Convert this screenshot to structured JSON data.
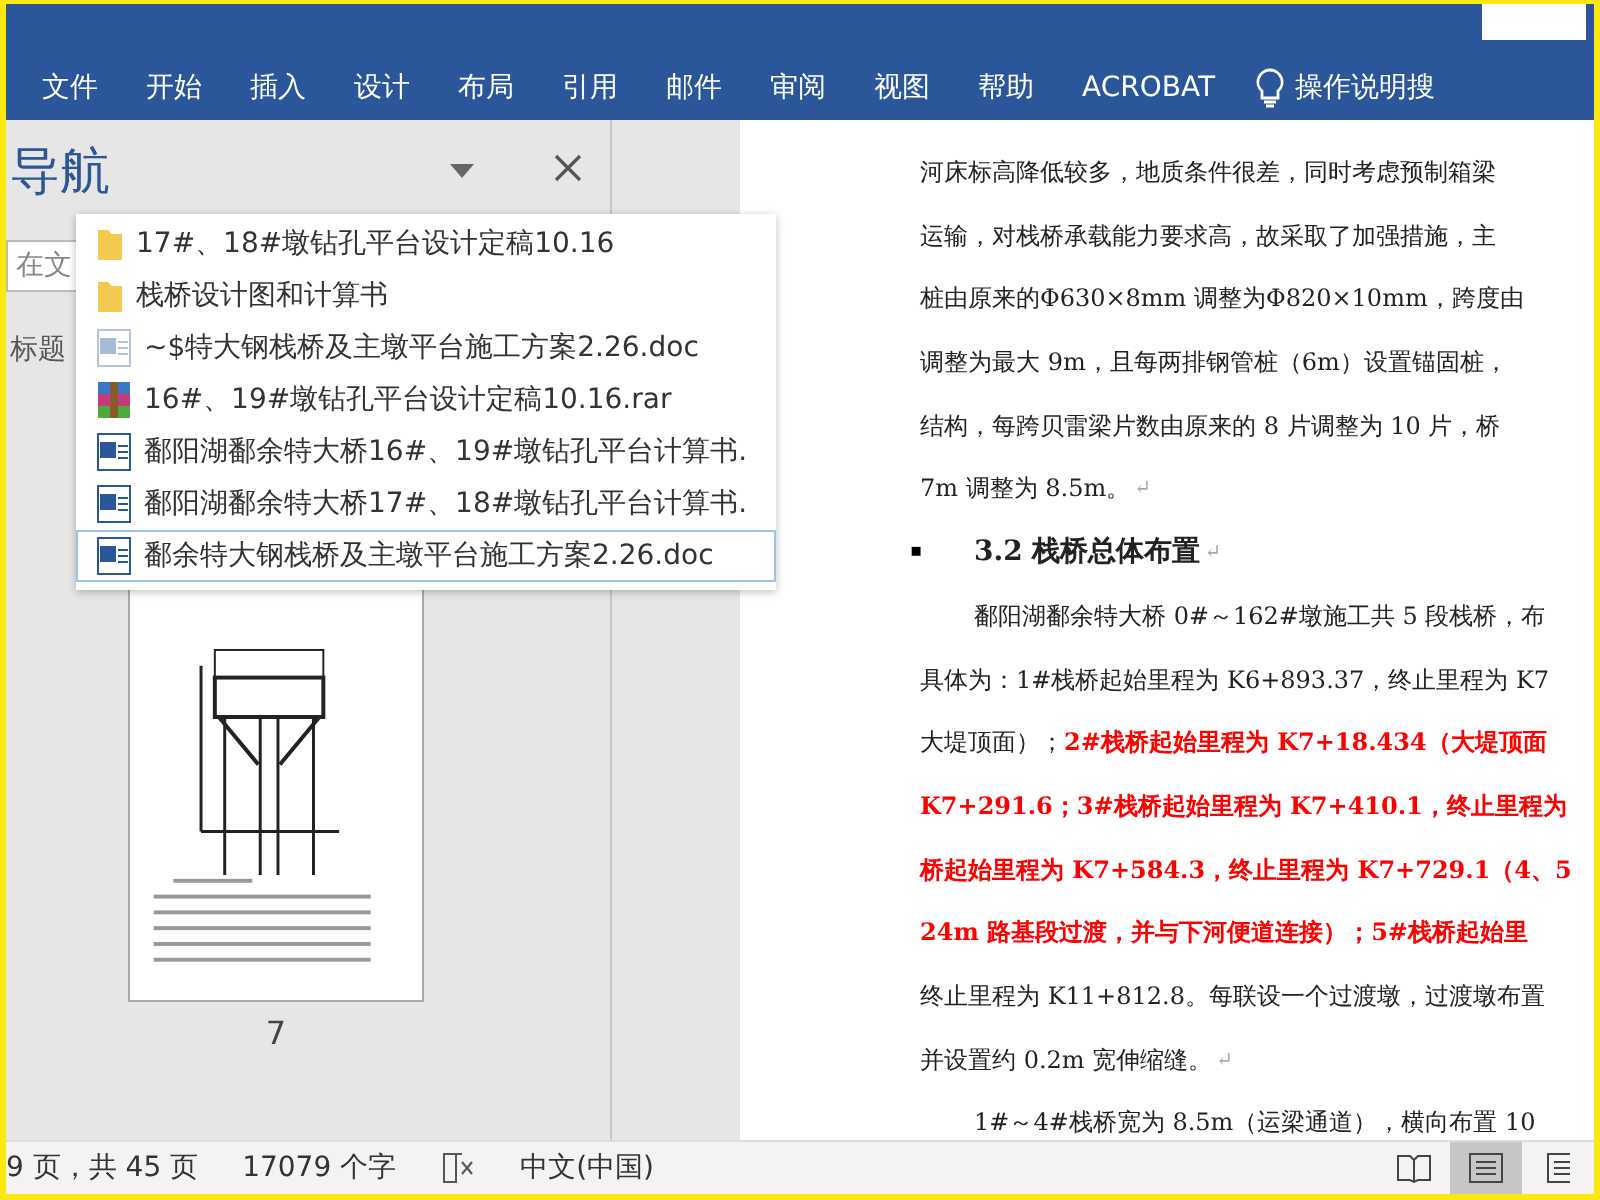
{
  "ribbon": {
    "tabs": [
      {
        "label": "文件"
      },
      {
        "label": "开始"
      },
      {
        "label": "插入"
      },
      {
        "label": "设计"
      },
      {
        "label": "布局"
      },
      {
        "label": "引用"
      },
      {
        "label": "邮件"
      },
      {
        "label": "审阅"
      },
      {
        "label": "视图"
      },
      {
        "label": "帮助"
      },
      {
        "label": "ACROBAT"
      }
    ],
    "tell_me": "操作说明搜"
  },
  "navigation": {
    "title": "导航",
    "search": {
      "placeholder": "在文"
    },
    "tab_label": "标题",
    "thumbnail_page": "7"
  },
  "file_popup": {
    "items": [
      {
        "kind": "folder",
        "name": "17#、18#墩钻孔平台设计定稿10.16",
        "selected": false
      },
      {
        "kind": "folder",
        "name": "栈桥设计图和计算书",
        "selected": false
      },
      {
        "kind": "word-temp",
        "name": "~$特大钢栈桥及主墩平台施工方案2.26.doc",
        "selected": false
      },
      {
        "kind": "archive",
        "name": "16#、19#墩钻孔平台设计定稿10.16.rar",
        "selected": false
      },
      {
        "kind": "word",
        "name": "鄱阳湖鄱余特大桥16#、19#墩钻孔平台计算书.",
        "selected": false
      },
      {
        "kind": "word",
        "name": "鄱阳湖鄱余特大桥17#、18#墩钻孔平台计算书.",
        "selected": false
      },
      {
        "kind": "word",
        "name": "鄱余特大钢栈桥及主墩平台施工方案2.26.doc",
        "selected": true
      }
    ]
  },
  "document": {
    "lines": [
      {
        "kind": "text",
        "indent": false,
        "segments": [
          {
            "text": "河床标高降低较多，地质条件很差，同时考虑预制箱梁",
            "red": false
          }
        ]
      },
      {
        "kind": "text",
        "indent": false,
        "segments": [
          {
            "text": "运输，对栈桥承载能力要求高，故采取了加强措施，主",
            "red": false
          }
        ]
      },
      {
        "kind": "text",
        "indent": false,
        "segments": [
          {
            "text": "桩由原来的Φ630×8mm 调整为Φ820×10mm，跨度由",
            "red": false
          }
        ]
      },
      {
        "kind": "text",
        "indent": false,
        "segments": [
          {
            "text": "调整为最大 9m，且每两排钢管桩（6m）设置锚固桩，",
            "red": false
          }
        ]
      },
      {
        "kind": "text",
        "indent": false,
        "segments": [
          {
            "text": "结构，每跨贝雷梁片数由原来的 8 片调整为 10 片，桥",
            "red": false
          }
        ]
      },
      {
        "kind": "text",
        "indent": false,
        "end_mark": "↵",
        "segments": [
          {
            "text": "7m 调整为 8.5m。",
            "red": false
          }
        ]
      },
      {
        "kind": "heading",
        "bullet": "▪",
        "end_mark": "↵",
        "segments": [
          {
            "text": "3.2 栈桥总体布置",
            "red": false
          }
        ]
      },
      {
        "kind": "text",
        "indent": true,
        "segments": [
          {
            "text": "鄱阳湖鄱余特大桥 0#～162#墩施工共 5 段栈桥，布",
            "red": false
          }
        ]
      },
      {
        "kind": "text",
        "indent": false,
        "segments": [
          {
            "text": "具体为：1#栈桥起始里程为 K6+893.37，终止里程为 K7",
            "red": false
          }
        ]
      },
      {
        "kind": "text",
        "indent": false,
        "segments": [
          {
            "text": "大堤顶面）；",
            "red": false
          },
          {
            "text": "2#栈桥起始里程为 K7+18.434（大堤顶面",
            "red": true
          }
        ]
      },
      {
        "kind": "text",
        "indent": false,
        "segments": [
          {
            "text": "K7+291.6；3#栈桥起始里程为 K7+410.1，终止里程为",
            "red": true
          }
        ]
      },
      {
        "kind": "text",
        "indent": false,
        "segments": [
          {
            "text": "桥起始里程为 K7+584.3，终止里程为 K7+729.1（4、5",
            "red": true
          }
        ]
      },
      {
        "kind": "text",
        "indent": false,
        "segments": [
          {
            "text": "24m 路基段过渡，并与下河便道连接）；5#栈桥起始里",
            "red": true
          }
        ]
      },
      {
        "kind": "text",
        "indent": false,
        "segments": [
          {
            "text": "终止里程为 K11+812.8。每联设一个过渡墩，过渡墩布置",
            "red": false
          }
        ]
      },
      {
        "kind": "text",
        "indent": false,
        "end_mark": "↵",
        "segments": [
          {
            "text": "并设置约 0.2m 宽伸缩缝。",
            "red": false
          }
        ]
      },
      {
        "kind": "text",
        "indent": true,
        "segments": [
          {
            "text": "1#～4#栈桥宽为 8.5m（运梁通道），横向布置 10",
            "red": false
          }
        ]
      }
    ]
  },
  "status_bar": {
    "page": "9 页，共 45 页",
    "words": "17079 个字",
    "language": "中文(中国)",
    "views": [
      {
        "kind": "read",
        "selected": false
      },
      {
        "kind": "print",
        "selected": true
      },
      {
        "kind": "web",
        "selected": false
      }
    ]
  }
}
